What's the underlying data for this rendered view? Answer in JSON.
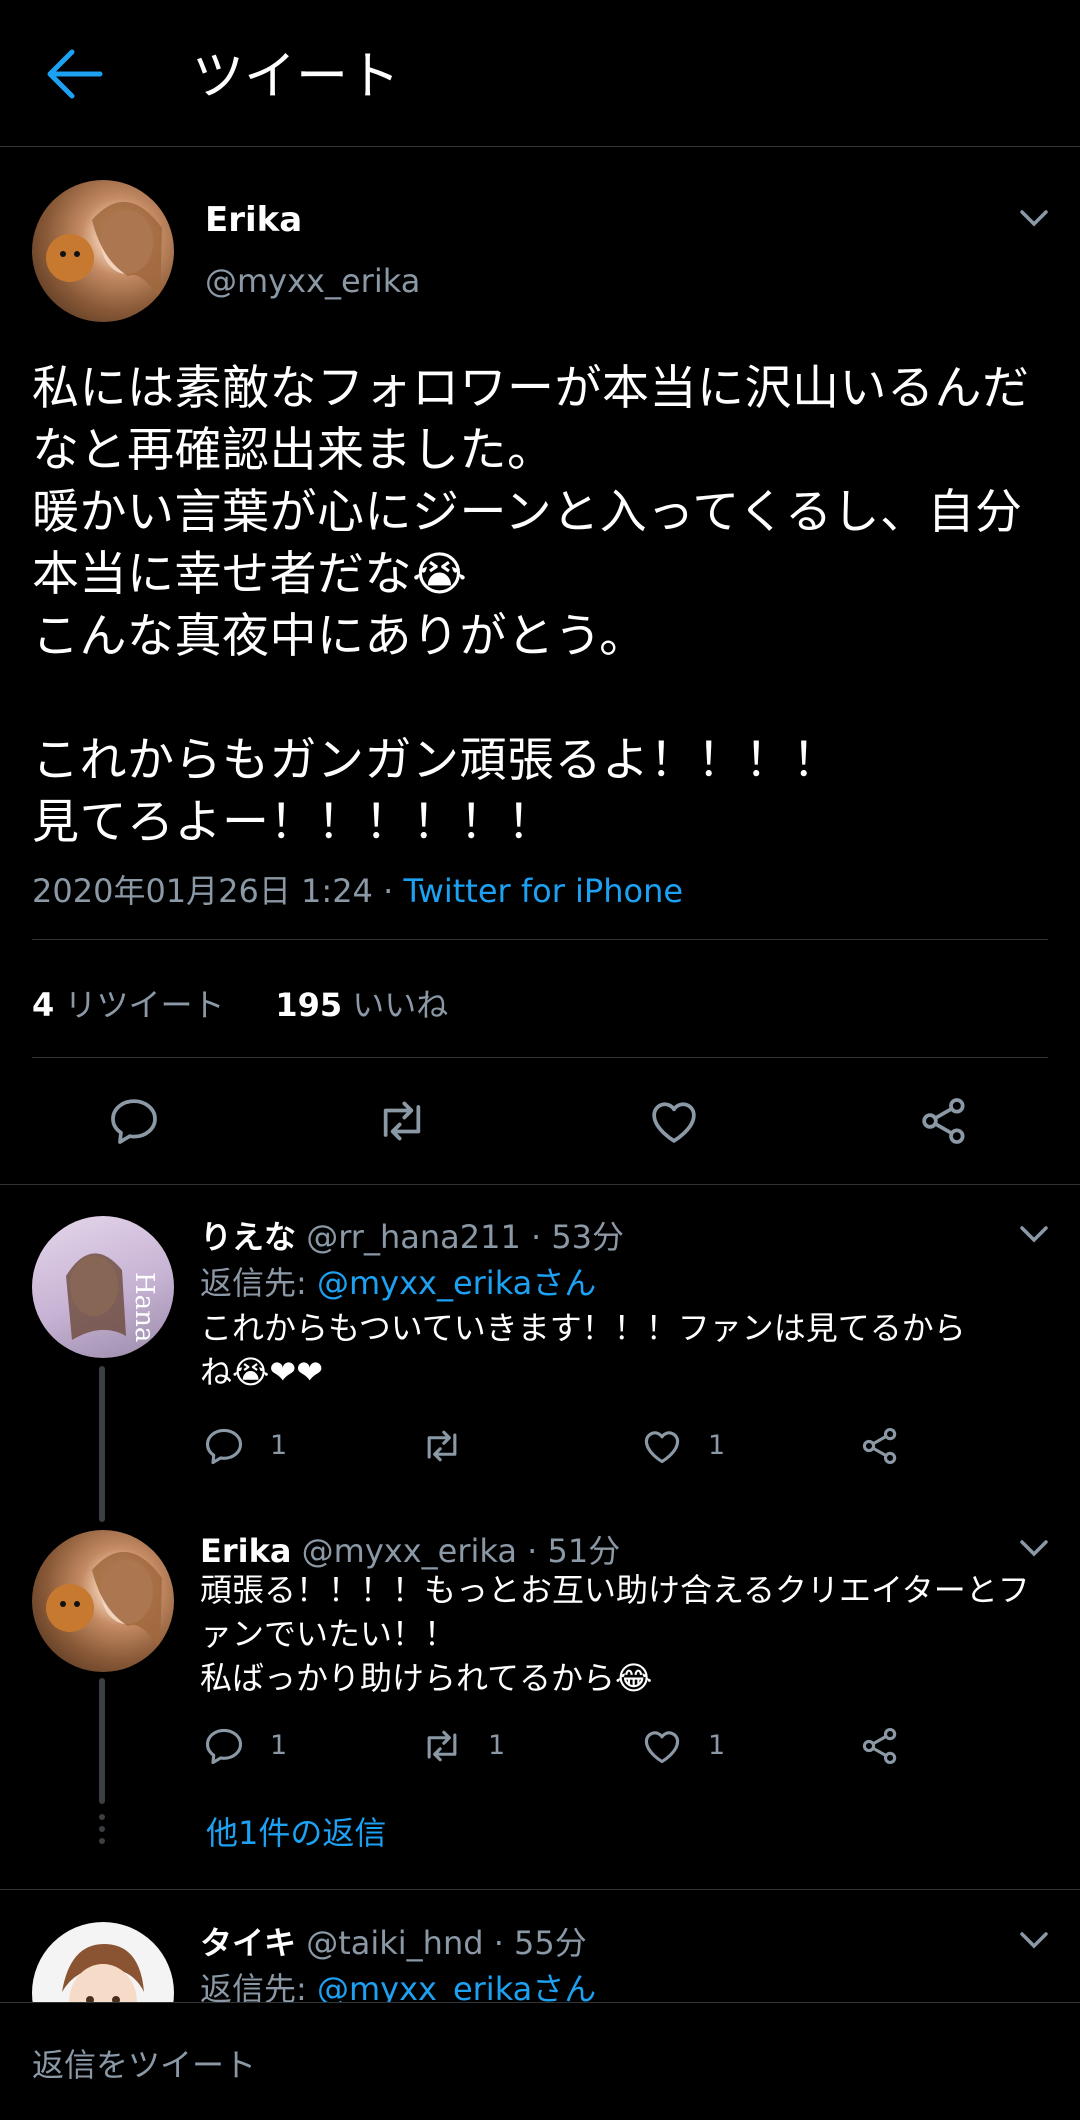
{
  "header": {
    "title": "ツイート"
  },
  "main_tweet": {
    "name": "Erika",
    "handle": "@myxx_erika",
    "text": "私には素敵なフォロワーが本当に沢山いるんだなと再確認出来ました。\n暖かい言葉が心にジーンと入ってくるし、自分本当に幸せ者だな😭\nこんな真夜中にありがとう。\n\nこれからもガンガン頑張るよ！！！！\n見てろよー！！！！！！",
    "timestamp": "2020年01月26日 1:24",
    "separator": " · ",
    "source": "Twitter for iPhone",
    "retweet_count": "4",
    "retweet_label": "リツイート",
    "like_count": "195",
    "like_label": "いいね"
  },
  "replies": [
    {
      "name": "りえな",
      "handle": "@rr_hana211",
      "time": "53分",
      "reply_to_prefix": "返信先: ",
      "reply_to": "@myxx_erikaさん",
      "text": "これからもついていきます！！！ファンは見てるから\nね😭❤❤",
      "reply_count": "1",
      "retweet_count": "",
      "like_count": "1"
    },
    {
      "name": "Erika",
      "handle": "@myxx_erika",
      "time": "51分",
      "text": "頑張る！！！！もっとお互い助け合えるクリエイターとファンでいたい！！\n私ばっかり助けられてるから😂",
      "reply_count": "1",
      "retweet_count": "1",
      "like_count": "1",
      "more_replies": "他1件の返信"
    },
    {
      "name": "タイキ",
      "handle": "@taiki_hnd",
      "time": "55分",
      "reply_to_prefix": "返信先: ",
      "reply_to": "@myxx_erikaさん"
    }
  ],
  "reply_bar": {
    "placeholder": "返信をツイート"
  },
  "colors": {
    "background": "#000000",
    "accent": "#1da1f2",
    "muted": "#8b98a5",
    "divider": "#2f3336",
    "heart": "#e0245e"
  },
  "icons": [
    "back-arrow-icon",
    "chevron-down-icon",
    "reply-icon",
    "retweet-icon",
    "like-icon",
    "share-icon"
  ]
}
